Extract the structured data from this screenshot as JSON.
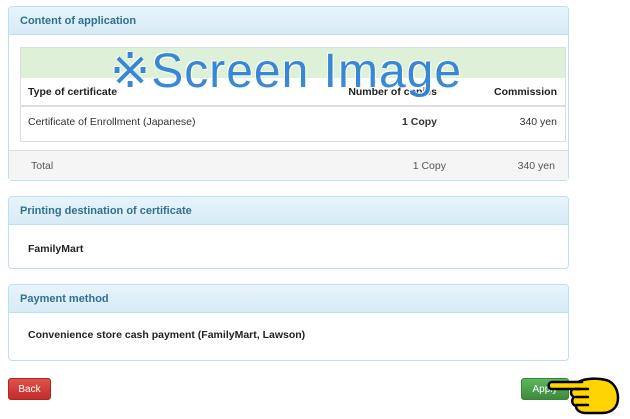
{
  "content_panel": {
    "heading": "Content of application",
    "columns": [
      "Type of certificate",
      "Number of copies",
      "Commission"
    ],
    "rows": [
      {
        "type": "Certificate of Enrollment (Japanese)",
        "copies": "1 Copy",
        "commission": "340 yen"
      }
    ],
    "total": {
      "label": "Total",
      "copies": "1 Copy",
      "commission": "340 yen"
    }
  },
  "watermark": "※Screen Image",
  "printing_panel": {
    "heading": "Printing destination of certificate",
    "value": "FamilyMart"
  },
  "payment_panel": {
    "heading": "Payment method",
    "value": "Convenience store cash payment (FamilyMart, Lawson)"
  },
  "actions": {
    "back_label": "Back",
    "apply_label": "Apply"
  },
  "colors": {
    "panel_heading_text": "#31708f",
    "panel_heading_bg": "#d9edf7",
    "table_header_band": "#dff0d8",
    "back_button": "#d9534f",
    "apply_button": "#5cb85c",
    "pointer_hand": "#ffd400",
    "watermark": "#2a7fd4"
  },
  "icons": {
    "pointer": "pointing-hand-icon"
  }
}
